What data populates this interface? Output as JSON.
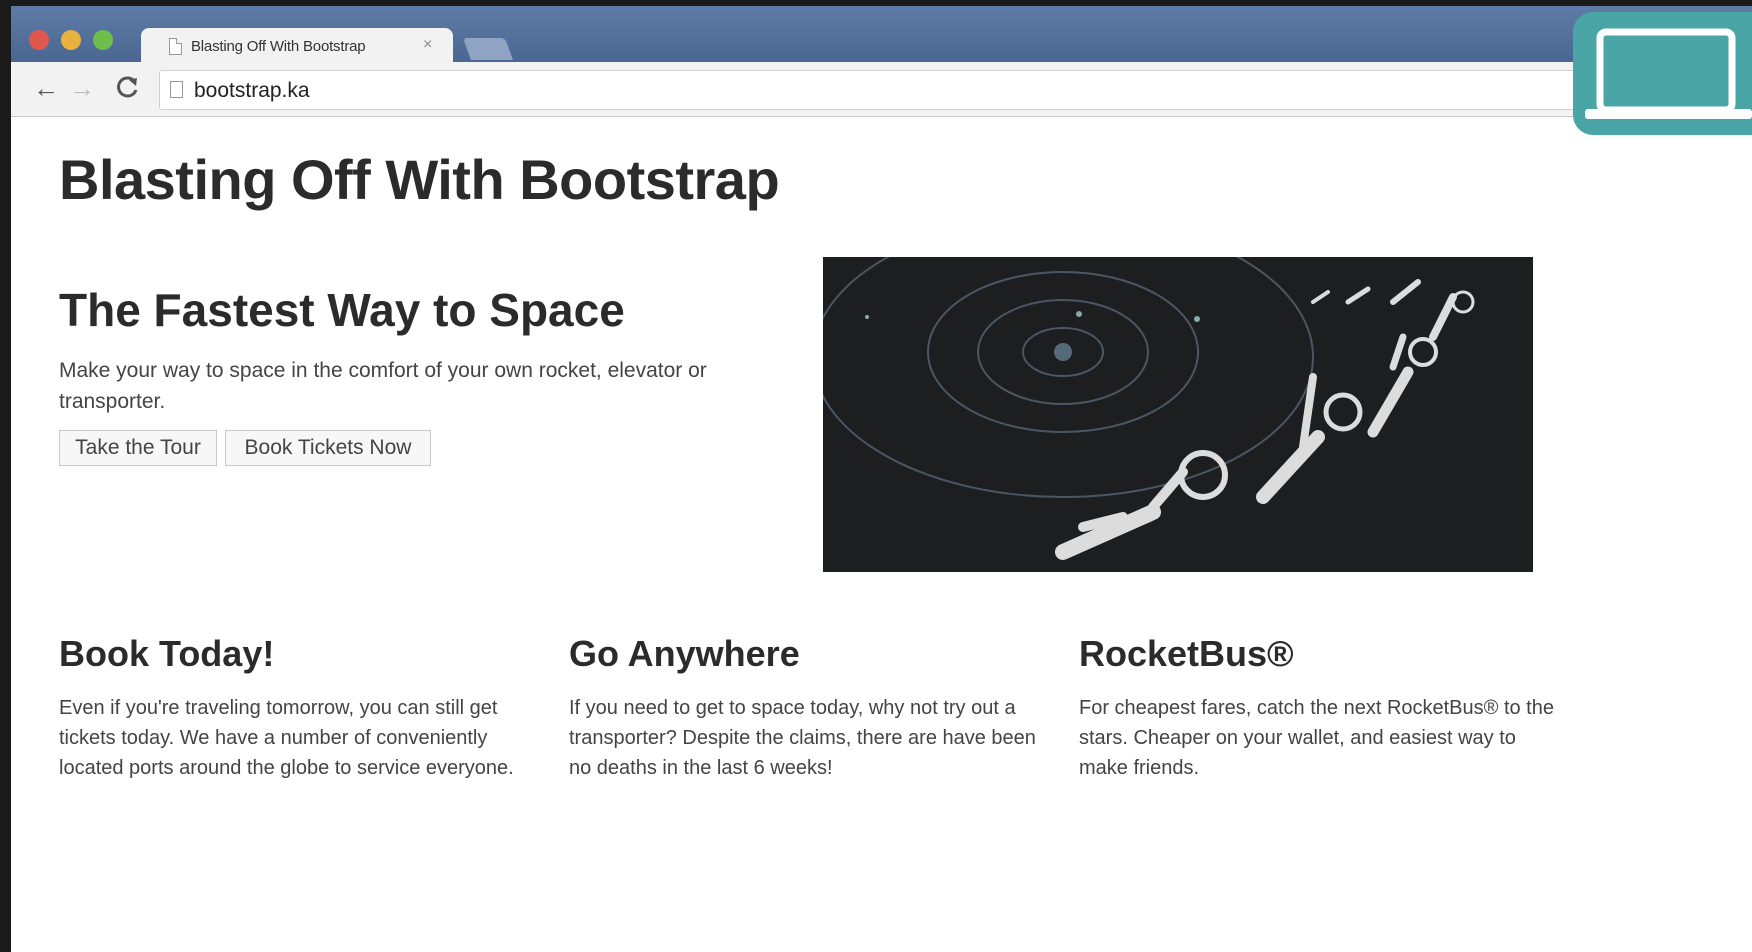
{
  "browser": {
    "tab_title": "Blasting Off With Bootstrap",
    "tab_close": "×",
    "back_icon": "←",
    "forward_icon": "→",
    "reload_icon": "C",
    "url": "bootstrap.ka"
  },
  "page": {
    "title": "Blasting Off With Bootstrap",
    "hero": {
      "heading": "The Fastest Way to Space",
      "text": "Make your way to space in the comfort of your own rocket, elevator or transporter.",
      "buttons": [
        "Take the Tour",
        "Book Tickets Now"
      ]
    },
    "features": [
      {
        "heading": "Book Today!",
        "text": "Even if you're traveling tomorrow, you can still get tickets today. We have a number of conveniently located ports around the globe to service everyone."
      },
      {
        "heading": "Go Anywhere",
        "text": "If you need to get to space today, why not try out a transporter? Despite the claims, there are have been no deaths in the last 6 weeks!"
      },
      {
        "heading": "RocketBus®",
        "text": "For cheapest fares, catch the next RocketBus® to the stars. Cheaper on your wallet, and easiest way to make friends."
      }
    ]
  },
  "colors": {
    "badge": "#4aa6a6",
    "tabbar": "#4a6791",
    "hero_image_bg": "#1d1e20"
  },
  "icons": {
    "badge": "laptop-icon",
    "hero_image": "astronauts-orbit-illustration"
  }
}
